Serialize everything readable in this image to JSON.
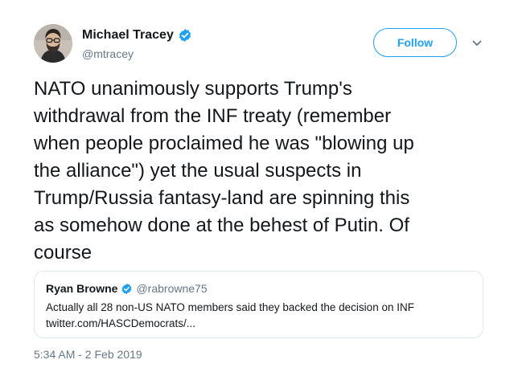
{
  "author": {
    "display_name": "Michael Tracey",
    "handle": "@mtracey",
    "avatar_icon": "user-avatar-icon",
    "verified_icon": "verified-badge-icon"
  },
  "follow_button": {
    "label": "Follow"
  },
  "more_menu_icon": "chevron-down-icon",
  "tweet": {
    "lines": [
      "NATO unanimously supports Trump's",
      "withdrawal from the INF treaty (remember",
      "when people proclaimed he was \"blowing up",
      "the alliance\") yet the usual suspects in",
      "Trump/Russia fantasy-land are spinning this",
      "as somehow done at the behest of Putin. Of",
      "course"
    ]
  },
  "quoted_tweet": {
    "display_name": "Ryan Browne",
    "handle": "@rabrowne75",
    "verified_icon": "verified-badge-icon",
    "lines": [
      "Actually all 28 non-US NATO members said they backed the decision on INF",
      "twitter.com/HASCDemocrats/..."
    ]
  },
  "timestamp": "5:34 AM - 2 Feb 2019",
  "colors": {
    "accent": "#1da1f2",
    "text": "#14171a",
    "secondary_text": "#657786",
    "border": "#e1e8ed"
  }
}
